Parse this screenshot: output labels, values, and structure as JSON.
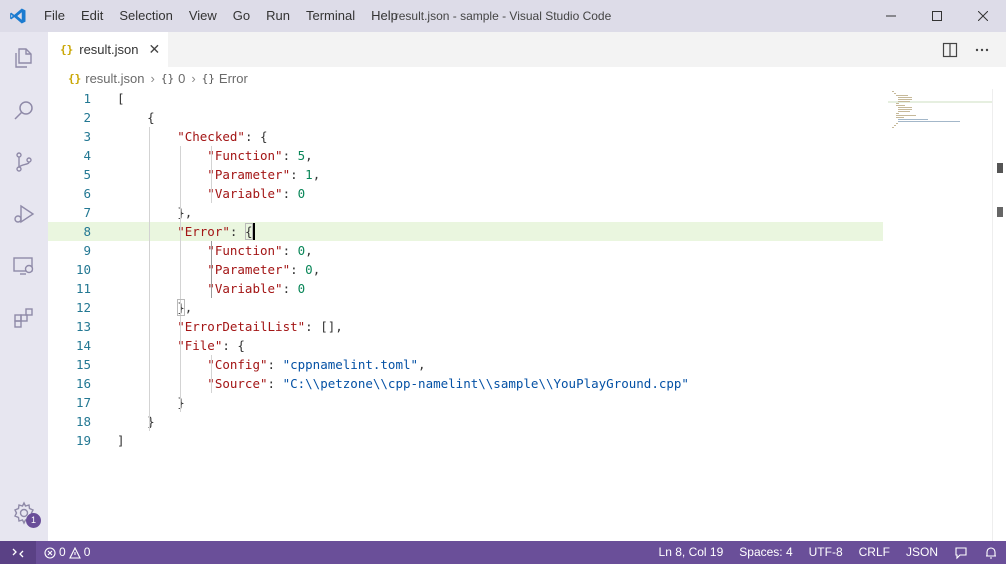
{
  "window": {
    "title": "result.json - sample - Visual Studio Code",
    "menu": [
      "File",
      "Edit",
      "Selection",
      "View",
      "Go",
      "Run",
      "Terminal",
      "Help"
    ]
  },
  "activity_bar": {
    "icons": [
      "explorer-icon",
      "search-icon",
      "source-control-icon",
      "run-debug-icon",
      "remote-explorer-icon",
      "extensions-icon"
    ],
    "manage_badge": "1"
  },
  "tabs": [
    {
      "label": "result.json",
      "icon": "json-file-icon",
      "icon_text": "{}"
    }
  ],
  "breadcrumb": {
    "file": "result.json",
    "file_icon_text": "{}",
    "obj_icon_text": "{}",
    "items": [
      "0",
      "Error"
    ]
  },
  "editor": {
    "current_line": 8,
    "line_numbers": [
      "1",
      "2",
      "3",
      "4",
      "5",
      "6",
      "7",
      "8",
      "9",
      "10",
      "11",
      "12",
      "13",
      "14",
      "15",
      "16",
      "17",
      "18",
      "19"
    ],
    "lines": [
      [
        {
          "t": "p",
          "v": "["
        }
      ],
      [
        {
          "t": "p",
          "v": "    {"
        }
      ],
      [
        {
          "t": "k",
          "v": "        \"Checked\""
        },
        {
          "t": "p",
          "v": ": {"
        }
      ],
      [
        {
          "t": "k",
          "v": "            \"Function\""
        },
        {
          "t": "p",
          "v": ": "
        },
        {
          "t": "n",
          "v": "5"
        },
        {
          "t": "p",
          "v": ","
        }
      ],
      [
        {
          "t": "k",
          "v": "            \"Parameter\""
        },
        {
          "t": "p",
          "v": ": "
        },
        {
          "t": "n",
          "v": "1"
        },
        {
          "t": "p",
          "v": ","
        }
      ],
      [
        {
          "t": "k",
          "v": "            \"Variable\""
        },
        {
          "t": "p",
          "v": ": "
        },
        {
          "t": "n",
          "v": "0"
        }
      ],
      [
        {
          "t": "p",
          "v": "        },"
        }
      ],
      [
        {
          "t": "k",
          "v": "        \"Error\""
        },
        {
          "t": "p",
          "v": ": {"
        }
      ],
      [
        {
          "t": "k",
          "v": "            \"Function\""
        },
        {
          "t": "p",
          "v": ": "
        },
        {
          "t": "n",
          "v": "0"
        },
        {
          "t": "p",
          "v": ","
        }
      ],
      [
        {
          "t": "k",
          "v": "            \"Parameter\""
        },
        {
          "t": "p",
          "v": ": "
        },
        {
          "t": "n",
          "v": "0"
        },
        {
          "t": "p",
          "v": ","
        }
      ],
      [
        {
          "t": "k",
          "v": "            \"Variable\""
        },
        {
          "t": "p",
          "v": ": "
        },
        {
          "t": "n",
          "v": "0"
        }
      ],
      [
        {
          "t": "p",
          "v": "        },"
        }
      ],
      [
        {
          "t": "k",
          "v": "        \"ErrorDetailList\""
        },
        {
          "t": "p",
          "v": ": [],"
        }
      ],
      [
        {
          "t": "k",
          "v": "        \"File\""
        },
        {
          "t": "p",
          "v": ": {"
        }
      ],
      [
        {
          "t": "k",
          "v": "            \"Config\""
        },
        {
          "t": "p",
          "v": ": "
        },
        {
          "t": "s",
          "v": "\"cppnamelint.toml\""
        },
        {
          "t": "p",
          "v": ","
        }
      ],
      [
        {
          "t": "k",
          "v": "            \"Source\""
        },
        {
          "t": "p",
          "v": ": "
        },
        {
          "t": "s",
          "v": "\"C:\\\\petzone\\\\cpp-namelint\\\\sample\\\\YouPlayGround.cpp\""
        }
      ],
      [
        {
          "t": "p",
          "v": "        }"
        }
      ],
      [
        {
          "t": "p",
          "v": "    }"
        }
      ],
      [
        {
          "t": "p",
          "v": "]"
        }
      ]
    ]
  },
  "status_bar": {
    "errors": "0",
    "warnings": "0",
    "position": "Ln 8, Col 19",
    "indent": "Spaces: 4",
    "encoding": "UTF-8",
    "eol": "CRLF",
    "language": "JSON"
  },
  "colors": {
    "status_bar": "#6a4f99",
    "title_bar": "#dddce8",
    "activity_bar": "#e7e6f0",
    "current_line": "#eaf6df",
    "json_key": "#a31515",
    "json_string": "#0451a5",
    "json_number": "#098658",
    "line_number": "#237893"
  }
}
